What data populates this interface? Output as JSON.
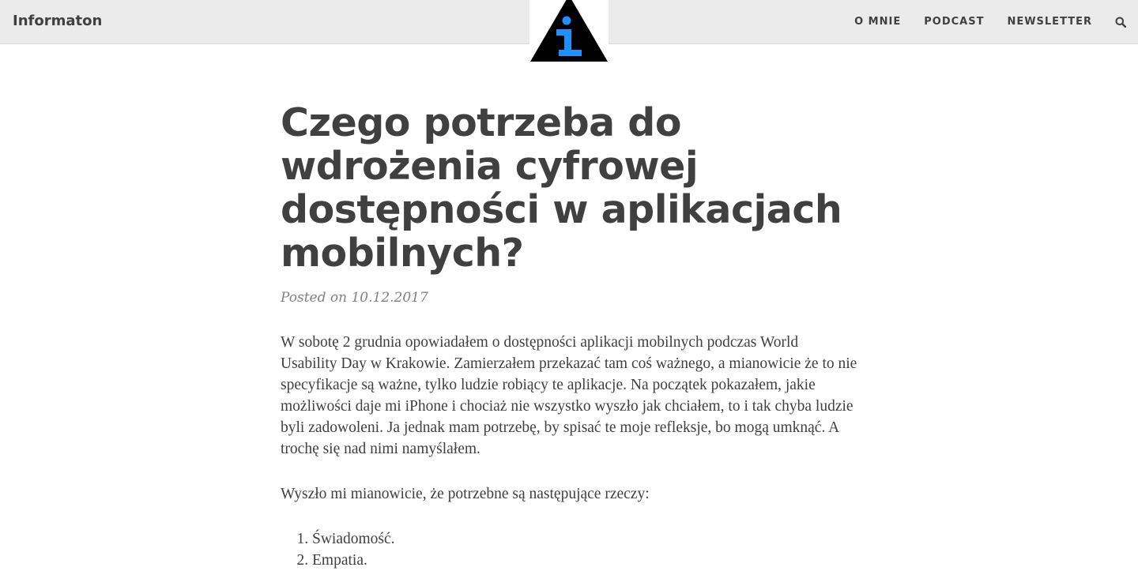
{
  "navbar": {
    "brand": "Informaton",
    "logo_icon": "info-warning-triangle-icon",
    "links": [
      {
        "label": "O MNIE"
      },
      {
        "label": "PODCAST"
      },
      {
        "label": "NEWSLETTER"
      }
    ],
    "search_icon": "search-icon"
  },
  "post": {
    "title": "Czego potrzeba do wdrożenia cyfrowej dostępności w aplikacjach mobilnych?",
    "meta": "Posted on 10.12.2017",
    "paragraphs": [
      "W sobotę 2 grudnia opowiadałem o dostępności aplikacji mobilnych podczas World Usability Day w Krakowie. Zamierzałem przekazać tam coś ważnego, a mianowicie że to nie specyfikacje są ważne, tylko ludzie robiący te aplikacje. Na początek pokazałem, jakie możliwości daje mi iPhone i chociaż nie wszystko wyszło jak chciałem, to i tak chyba ludzie byli zadowoleni. Ja jednak mam potrzebę, by spisać te moje refleksje, bo mogą umknąć. A trochę się nad nimi namyślałem.",
      "Wyszło mi mianowicie, że potrzebne są następujące rzeczy:"
    ],
    "list": [
      "Świadomość.",
      "Empatia."
    ]
  },
  "colors": {
    "navbar_bg": "#ebebeb",
    "text": "#404040",
    "meta_text": "#808080",
    "logo_triangle": "#000000",
    "logo_i": "#1e90ff"
  }
}
